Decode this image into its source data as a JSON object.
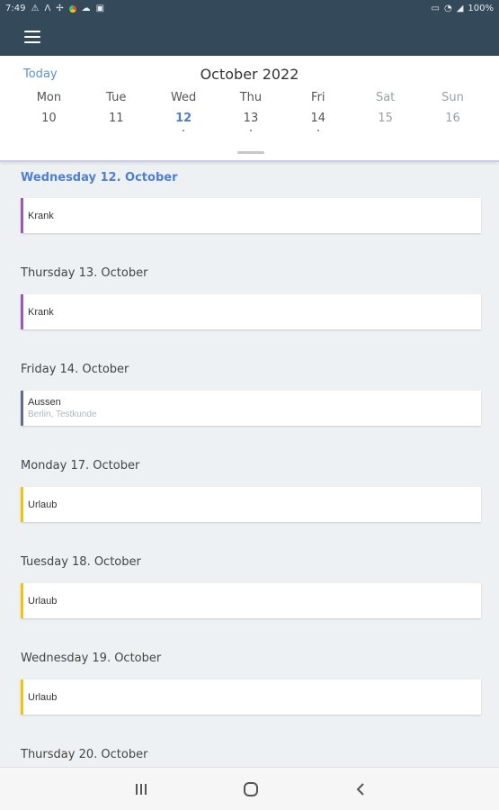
{
  "status": {
    "time": "7:49",
    "battery": "100%"
  },
  "calendar": {
    "today_label": "Today",
    "month_title": "October 2022",
    "days": [
      {
        "name": "Mon",
        "num": "10"
      },
      {
        "name": "Tue",
        "num": "11"
      },
      {
        "name": "Wed",
        "num": "12"
      },
      {
        "name": "Thu",
        "num": "13"
      },
      {
        "name": "Fri",
        "num": "14"
      },
      {
        "name": "Sat",
        "num": "15"
      },
      {
        "name": "Sun",
        "num": "16"
      }
    ]
  },
  "agenda": [
    {
      "heading": "Wednesday 12. October",
      "events": [
        {
          "title": "Krank",
          "subtitle": "",
          "color": "#9b59b6"
        }
      ]
    },
    {
      "heading": "Thursday 13. October",
      "events": [
        {
          "title": "Krank",
          "subtitle": "",
          "color": "#9b59b6"
        }
      ]
    },
    {
      "heading": "Friday 14. October",
      "events": [
        {
          "title": "Aussen",
          "subtitle": "Berlin, Testkunde",
          "color": "#5d6d8a"
        }
      ]
    },
    {
      "heading": "Monday 17. October",
      "events": [
        {
          "title": "Urlaub",
          "subtitle": "",
          "color": "#f1c40f"
        }
      ]
    },
    {
      "heading": "Tuesday 18. October",
      "events": [
        {
          "title": "Urlaub",
          "subtitle": "",
          "color": "#f1c40f"
        }
      ]
    },
    {
      "heading": "Wednesday 19. October",
      "events": [
        {
          "title": "Urlaub",
          "subtitle": "",
          "color": "#f1c40f"
        }
      ]
    },
    {
      "heading": "Thursday 20. October",
      "events": []
    }
  ],
  "colors": {
    "app_bar": "#34495a",
    "accent": "#4f7fd0"
  }
}
